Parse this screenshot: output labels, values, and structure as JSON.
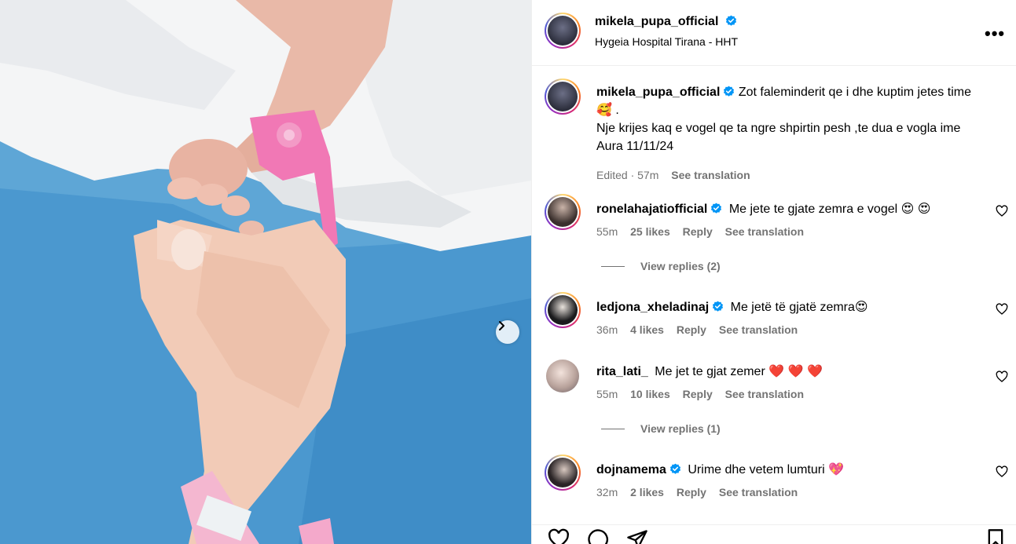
{
  "post": {
    "username": "mikela_pupa_official",
    "location": "Hygeia Hospital Tirana - HHT",
    "more_label": "•••"
  },
  "caption": {
    "username": "mikela_pupa_official",
    "line1": "Zot faleminderit qe i dhe kuptim jetes time 🥰 .",
    "line2": "Nje krijes kaq e vogel qe ta ngre shpirtin pesh ,te dua e vogla ime Aura 11/11/24",
    "edited": "Edited · 57m",
    "see_translation": "See translation"
  },
  "comments": [
    {
      "username": "ronelahajatiofficial",
      "verified": true,
      "text": "Me jete te gjate zemra e vogel 😍 😍",
      "time": "55m",
      "likes": "25 likes",
      "reply": "Reply",
      "translate": "See translation",
      "view_replies": "View replies (2)"
    },
    {
      "username": "ledjona_xheladinaj",
      "verified": true,
      "text": "Me jetë të gjatë zemra😍",
      "time": "36m",
      "likes": "4 likes",
      "reply": "Reply",
      "translate": "See translation",
      "view_replies": ""
    },
    {
      "username": "rita_lati_",
      "verified": false,
      "text": "Me jet te gjat zemer ❤️ ❤️ ❤️",
      "time": "55m",
      "likes": "10 likes",
      "reply": "Reply",
      "translate": "See translation",
      "view_replies": "View replies (1)"
    },
    {
      "username": "dojnamema",
      "verified": true,
      "text": "Urime dhe vetem lumturi 💖",
      "time": "32m",
      "likes": "2 likes",
      "reply": "Reply",
      "translate": "See translation",
      "view_replies": ""
    }
  ],
  "icons": {
    "like": "heart-icon",
    "comment": "comment-icon",
    "share": "share-icon",
    "save": "bookmark-icon",
    "next": "chevron-right-icon",
    "verified": "verified-badge-icon"
  },
  "colors": {
    "verified": "#0095f6",
    "meta_gray": "#737373",
    "border": "#efefef"
  }
}
